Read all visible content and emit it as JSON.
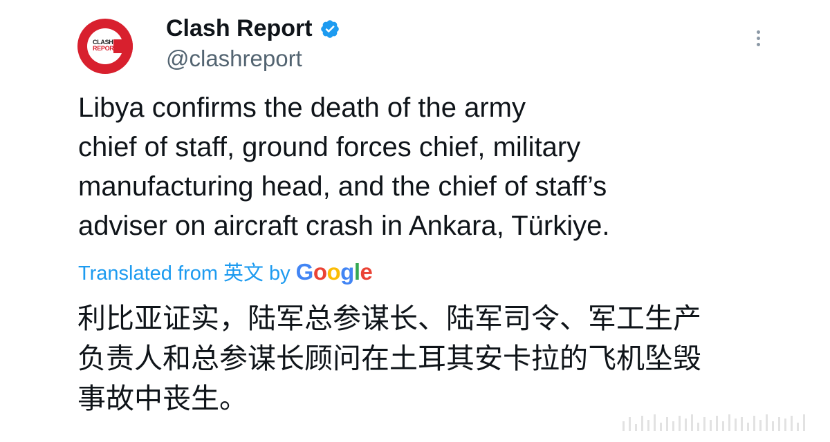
{
  "author": {
    "avatar_text_line1": "CLASH",
    "avatar_text_line2": "REPORT",
    "display_name": "Clash Report",
    "handle": "@clashreport",
    "verified": true,
    "verified_color": "#1d9bf0",
    "avatar_color": "#d8202e"
  },
  "menu": {
    "icon": "more-vertical-icon"
  },
  "tweet": {
    "text_lines": [
      "Libya confirms the death of the army",
      "chief of staff, ground forces chief, military",
      "manufacturing head, and the chief of staff’s",
      "adviser on aircraft crash in Ankara, Türkiye."
    ]
  },
  "translation": {
    "prefix": "Translated from",
    "source_language": "英文",
    "by": "by",
    "provider": "Google",
    "link_color": "#1d9bf0",
    "text_lines": [
      "利比亚证实，陆军总参谋长、陆军司令、军工生产",
      "负责人和总参谋长顾问在土耳其安卡拉的飞机坠毁",
      "事故中丧生。"
    ]
  }
}
